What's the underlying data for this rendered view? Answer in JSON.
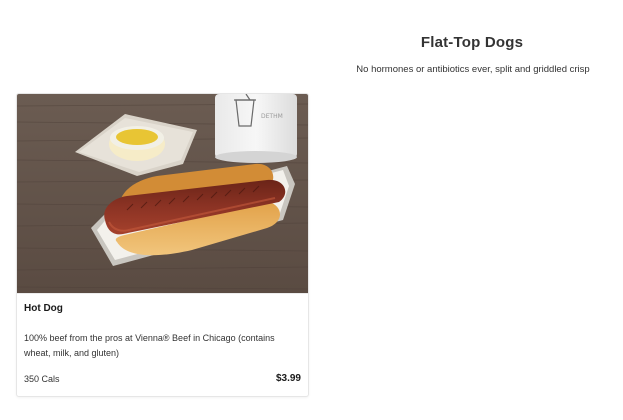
{
  "section": {
    "title": "Flat-Top Dogs",
    "subtitle": "No hormones or antibiotics ever, split and griddled crisp"
  },
  "item": {
    "image_icon": "hot-dog-photo",
    "name": "Hot Dog",
    "description": "100% beef from the pros at Vienna® Beef in Chicago (contains wheat, milk, and gluten)",
    "calories": "350 Cals",
    "price": "$3.99"
  }
}
